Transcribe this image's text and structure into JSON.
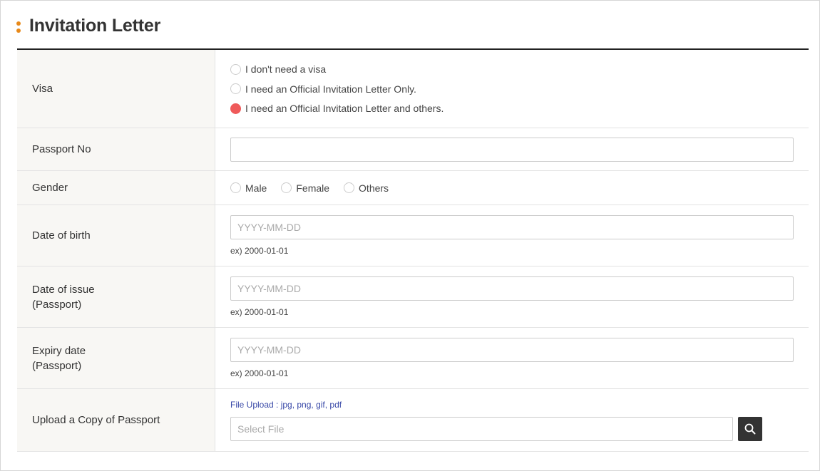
{
  "section": {
    "title": "Invitation Letter"
  },
  "form": {
    "visa": {
      "label": "Visa",
      "options": [
        {
          "label": "I don't need a visa",
          "checked": false
        },
        {
          "label": "I need an Official Invitation Letter Only.",
          "checked": false
        },
        {
          "label": "I need an Official Invitation Letter and others.",
          "checked": true
        }
      ]
    },
    "passport_no": {
      "label": "Passport No",
      "value": ""
    },
    "gender": {
      "label": "Gender",
      "options": [
        {
          "label": "Male",
          "checked": false
        },
        {
          "label": "Female",
          "checked": false
        },
        {
          "label": "Others",
          "checked": false
        }
      ]
    },
    "date_of_birth": {
      "label": "Date of birth",
      "placeholder": "YYYY-MM-DD",
      "hint": "ex) 2000-01-01"
    },
    "date_of_issue": {
      "label_line1": "Date of issue",
      "label_line2": "(Passport)",
      "placeholder": "YYYY-MM-DD",
      "hint": "ex) 2000-01-01"
    },
    "expiry_date": {
      "label_line1": "Expiry date",
      "label_line2": "(Passport)",
      "placeholder": "YYYY-MM-DD",
      "hint": "ex) 2000-01-01"
    },
    "upload": {
      "label": "Upload a Copy of Passport",
      "hint": "File Upload : jpg, png, gif, pdf",
      "placeholder": "Select File",
      "button_icon": "search-icon"
    }
  },
  "colors": {
    "accent_dot": "#e8891a",
    "radio_checked": "#ef5a5a",
    "upload_hint": "#3a4aa8",
    "search_button": "#333333"
  }
}
